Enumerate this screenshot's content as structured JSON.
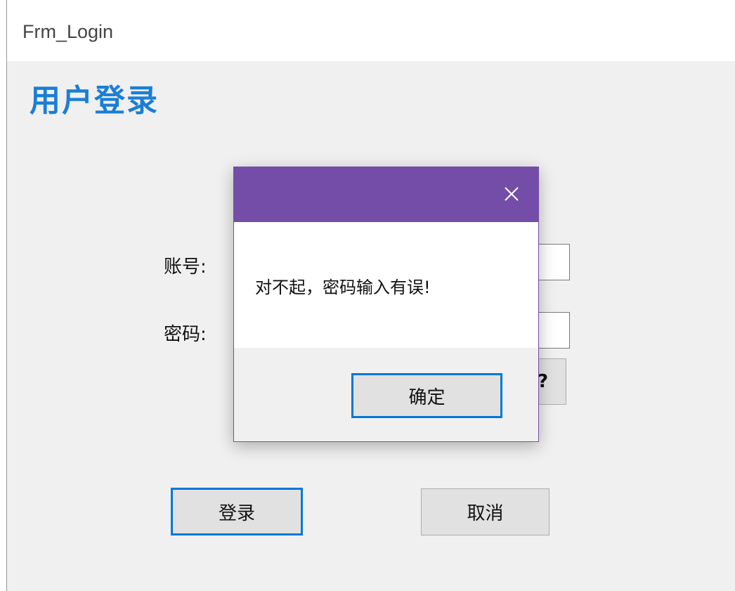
{
  "window": {
    "title": "Frm_Login"
  },
  "form": {
    "heading": "用户登录",
    "account_label": "账号:",
    "password_label": "密码:",
    "partial_button_label": "?",
    "login_button": "登录",
    "cancel_button": "取消"
  },
  "dialog": {
    "title": "",
    "close_icon": "close-icon",
    "message": "对不起，密码输入有误!",
    "ok_button": "确定"
  },
  "colors": {
    "accent": "#0078d7",
    "dialog_titlebar": "#744da9",
    "heading": "#1a7ed6",
    "client_bg": "#f0f0f0"
  }
}
